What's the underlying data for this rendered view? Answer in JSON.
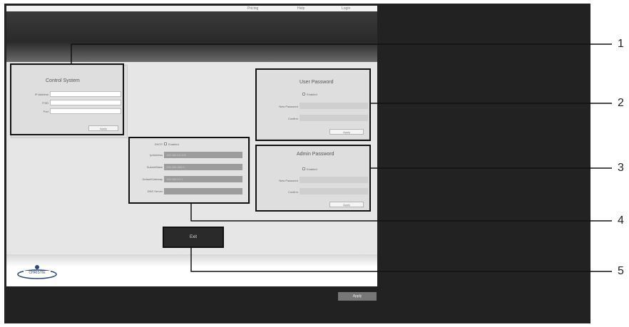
{
  "topbar": {
    "links": [
      "Pricing",
      "Help",
      "Login"
    ]
  },
  "control_system": {
    "title": "Control System",
    "fields": [
      {
        "label": "IP Address",
        "value": ""
      },
      {
        "label": "PJID",
        "value": ""
      },
      {
        "label": "Port",
        "value": ""
      }
    ],
    "button": "Apply"
  },
  "user_password": {
    "title": "User Password",
    "checkbox_label": "Enabled",
    "fields": [
      {
        "label": "New Password"
      },
      {
        "label": "Confirm"
      }
    ],
    "button": "Apply"
  },
  "admin_password": {
    "title": "Admin Password",
    "checkbox_label": "Enabled",
    "fields": [
      {
        "label": "New Password"
      },
      {
        "label": "Confirm"
      }
    ],
    "button": "Apply"
  },
  "network": {
    "dhcp_label": "DHCP",
    "dhcp_option": "Enabled",
    "fields": [
      {
        "label": "IpAddress",
        "value": "192.168.10.100"
      },
      {
        "label": "SubnetMask",
        "value": "255.255.255.0"
      },
      {
        "label": "DefaultGateway",
        "value": "192.168.10.1"
      },
      {
        "label": "DNS Server",
        "value": ""
      }
    ]
  },
  "save_button": "Exit",
  "footer": {
    "logo_text": "CHRISTIE",
    "copyright": ""
  },
  "bottom": {
    "link": "",
    "button": "Apply"
  },
  "callouts": [
    "1",
    "2",
    "3",
    "4",
    "5"
  ]
}
